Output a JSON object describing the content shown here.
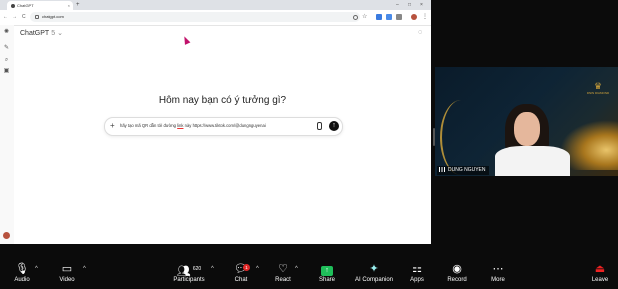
{
  "browser": {
    "tab_title": "ChatGPT",
    "tab_close": "×",
    "new_tab": "+",
    "url": "chatgpt.com",
    "nav": {
      "back": "←",
      "forward": "→",
      "reload": "C"
    },
    "window_controls": {
      "minimize": "–",
      "maximize": "□",
      "close": "×"
    }
  },
  "chatgpt": {
    "model_name": "ChatGPT",
    "model_version": "5",
    "model_caret": "⌄",
    "headline": "Hôm nay bạn có ý tưởng gì?",
    "prompt_prefix": "hãy tạo mã  QR dẫn tới đường ",
    "prompt_link_word": "link",
    "prompt_suffix": " này https://www.tiktok.com/@dungnguyenai",
    "plus": "+",
    "send": "↑"
  },
  "video": {
    "participant_name": "DUNG NGUYEN",
    "logo_mark": "♛",
    "logo_text": "DNIN DIAMOND"
  },
  "toolbar": {
    "audio": "Audio",
    "video": "Video",
    "participants": "Participants",
    "participants_count": "620",
    "chat": "Chat",
    "chat_badge": "1",
    "react": "React",
    "share": "Share",
    "ai_companion": "AI Companion",
    "apps": "Apps",
    "record": "Record",
    "more": "More",
    "leave": "Leave",
    "caret": "^"
  },
  "colors": {
    "share_green": "#1fbf5a",
    "leave_red": "#e22222",
    "badge_red": "#e02828",
    "cursor_magenta": "#c1126b"
  }
}
